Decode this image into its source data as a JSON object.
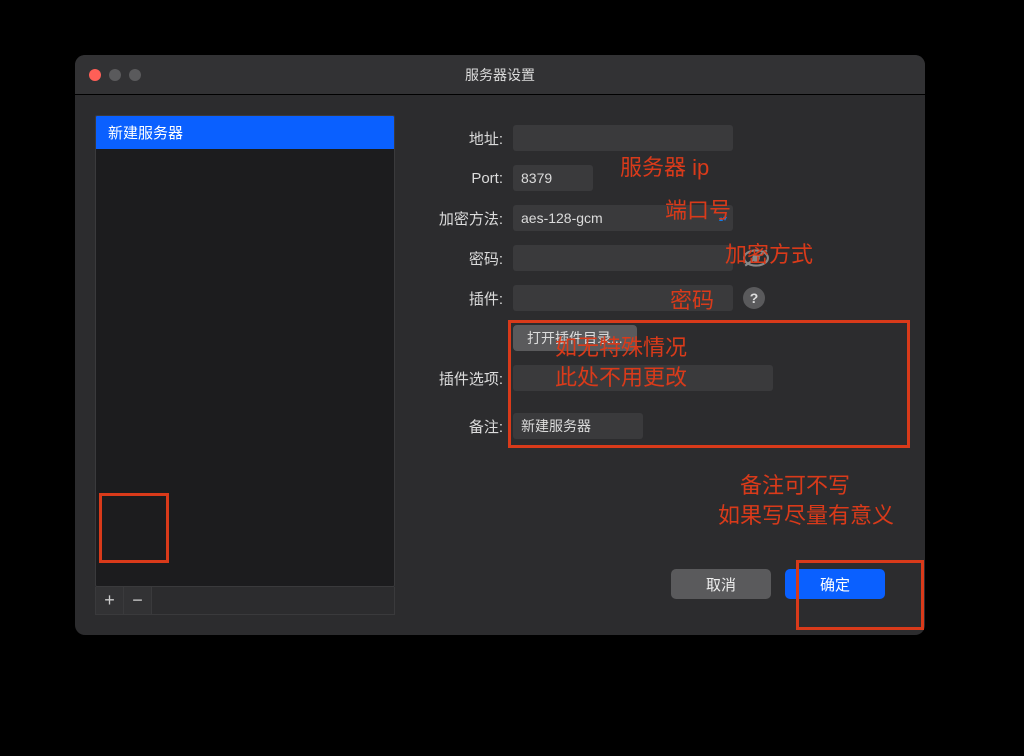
{
  "window": {
    "title": "服务器设置"
  },
  "sidebar": {
    "items": [
      "新建服务器"
    ],
    "add_label": "+",
    "remove_label": "−"
  },
  "form": {
    "address_label": "地址:",
    "address_value": "",
    "port_label": "Port:",
    "port_value": "8379",
    "encryption_label": "加密方法:",
    "encryption_value": "aes-128-gcm",
    "password_label": "密码:",
    "password_value": "",
    "plugin_label": "插件:",
    "plugin_value": "",
    "plugin_dir_button": "打开插件目录...",
    "plugin_options_label": "插件选项:",
    "plugin_options_value": "",
    "remark_label": "备注:",
    "remark_value": "新建服务器"
  },
  "buttons": {
    "cancel": "取消",
    "ok": "确定"
  },
  "annotations": {
    "address": "服务器 ip",
    "port": "端口号",
    "encryption": "加密方式",
    "password": "密码",
    "plugin_line1": "如无特殊情况",
    "plugin_line2": "此处不用更改",
    "remark_line1": "备注可不写",
    "remark_line2": "如果写尽量有意义"
  }
}
